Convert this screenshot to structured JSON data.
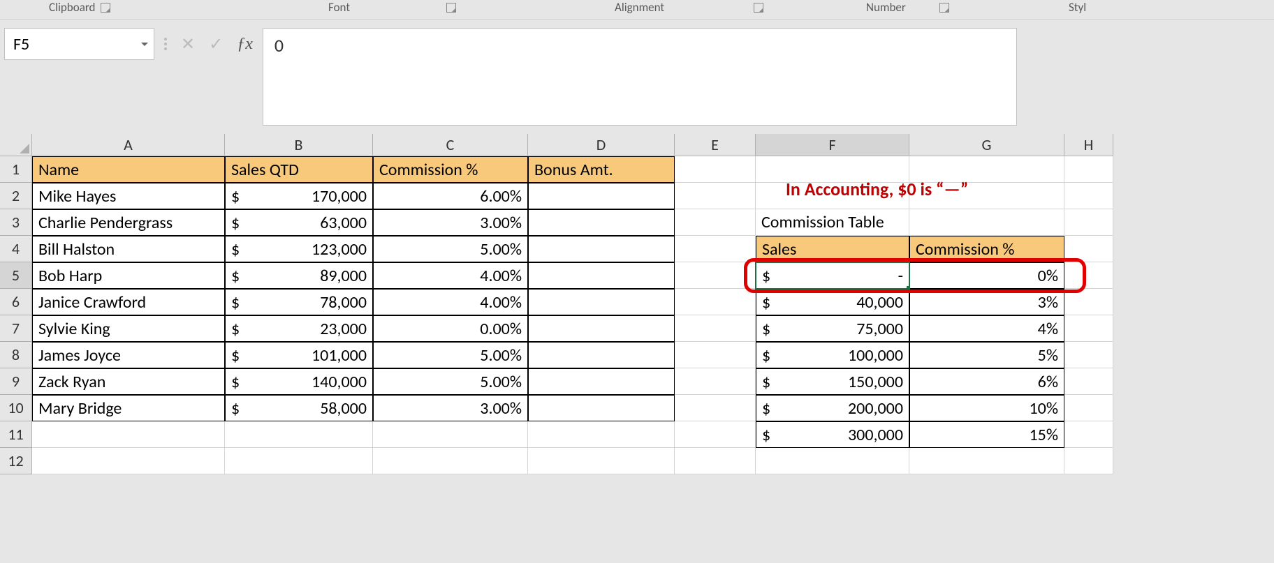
{
  "ribbon": {
    "clipboard": "Clipboard",
    "font": "Font",
    "alignment": "Alignment",
    "number": "Number",
    "styles": "Styl"
  },
  "nameBox": "F5",
  "formulaValue": "0",
  "columns": [
    "A",
    "B",
    "C",
    "D",
    "E",
    "F",
    "G",
    "H"
  ],
  "rows": [
    "1",
    "2",
    "3",
    "4",
    "5",
    "6",
    "7",
    "8",
    "9",
    "10",
    "11",
    "12"
  ],
  "headers": {
    "name": "Name",
    "salesQtd": "Sales QTD",
    "commission": "Commission %",
    "bonus": "Bonus Amt."
  },
  "employees": [
    {
      "name": "Mike Hayes",
      "sales": "170,000",
      "commission": "6.00%"
    },
    {
      "name": "Charlie Pendergrass",
      "sales": "63,000",
      "commission": "3.00%"
    },
    {
      "name": "Bill Halston",
      "sales": "123,000",
      "commission": "5.00%"
    },
    {
      "name": "Bob Harp",
      "sales": "89,000",
      "commission": "4.00%"
    },
    {
      "name": "Janice Crawford",
      "sales": "78,000",
      "commission": "4.00%"
    },
    {
      "name": "Sylvie King",
      "sales": "23,000",
      "commission": "0.00%"
    },
    {
      "name": "James Joyce",
      "sales": "101,000",
      "commission": "5.00%"
    },
    {
      "name": "Zack Ryan",
      "sales": "140,000",
      "commission": "5.00%"
    },
    {
      "name": "Mary Bridge",
      "sales": "58,000",
      "commission": "3.00%"
    }
  ],
  "commissionTable": {
    "title": "Commission Table",
    "salesHeader": "Sales",
    "commissionHeader": "Commission %",
    "rows": [
      {
        "sales": "-",
        "commission": "0%"
      },
      {
        "sales": "40,000",
        "commission": "3%"
      },
      {
        "sales": "75,000",
        "commission": "4%"
      },
      {
        "sales": "100,000",
        "commission": "5%"
      },
      {
        "sales": "150,000",
        "commission": "6%"
      },
      {
        "sales": "200,000",
        "commission": "10%"
      },
      {
        "sales": "300,000",
        "commission": "15%"
      }
    ]
  },
  "annotation": "In Accounting, $0 is “—”",
  "currency": "$"
}
